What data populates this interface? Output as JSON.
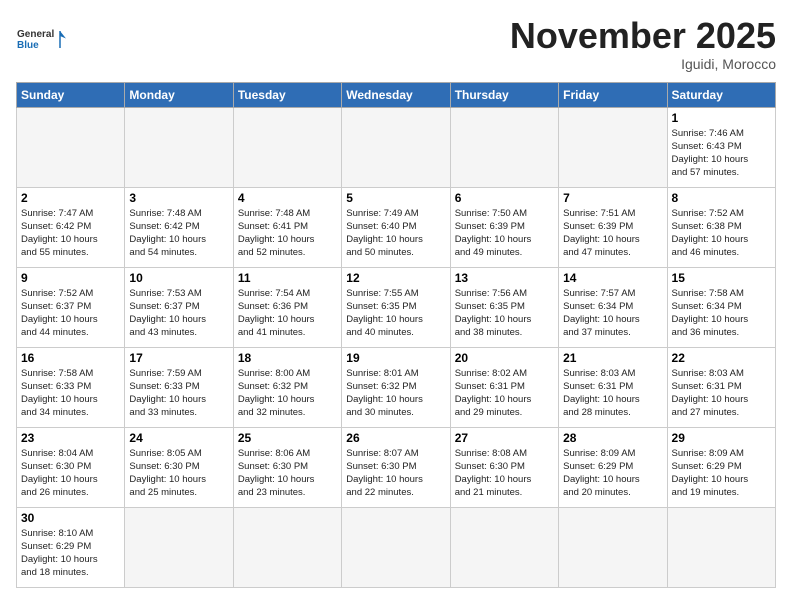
{
  "header": {
    "logo_general": "General",
    "logo_blue": "Blue",
    "month_title": "November 2025",
    "location": "Iguidi, Morocco"
  },
  "days_of_week": [
    "Sunday",
    "Monday",
    "Tuesday",
    "Wednesday",
    "Thursday",
    "Friday",
    "Saturday"
  ],
  "weeks": [
    [
      {
        "day": "",
        "info": ""
      },
      {
        "day": "",
        "info": ""
      },
      {
        "day": "",
        "info": ""
      },
      {
        "day": "",
        "info": ""
      },
      {
        "day": "",
        "info": ""
      },
      {
        "day": "",
        "info": ""
      },
      {
        "day": "1",
        "info": "Sunrise: 7:46 AM\nSunset: 6:43 PM\nDaylight: 10 hours\nand 57 minutes."
      }
    ],
    [
      {
        "day": "2",
        "info": "Sunrise: 7:47 AM\nSunset: 6:42 PM\nDaylight: 10 hours\nand 55 minutes."
      },
      {
        "day": "3",
        "info": "Sunrise: 7:48 AM\nSunset: 6:42 PM\nDaylight: 10 hours\nand 54 minutes."
      },
      {
        "day": "4",
        "info": "Sunrise: 7:48 AM\nSunset: 6:41 PM\nDaylight: 10 hours\nand 52 minutes."
      },
      {
        "day": "5",
        "info": "Sunrise: 7:49 AM\nSunset: 6:40 PM\nDaylight: 10 hours\nand 50 minutes."
      },
      {
        "day": "6",
        "info": "Sunrise: 7:50 AM\nSunset: 6:39 PM\nDaylight: 10 hours\nand 49 minutes."
      },
      {
        "day": "7",
        "info": "Sunrise: 7:51 AM\nSunset: 6:39 PM\nDaylight: 10 hours\nand 47 minutes."
      },
      {
        "day": "8",
        "info": "Sunrise: 7:52 AM\nSunset: 6:38 PM\nDaylight: 10 hours\nand 46 minutes."
      }
    ],
    [
      {
        "day": "9",
        "info": "Sunrise: 7:52 AM\nSunset: 6:37 PM\nDaylight: 10 hours\nand 44 minutes."
      },
      {
        "day": "10",
        "info": "Sunrise: 7:53 AM\nSunset: 6:37 PM\nDaylight: 10 hours\nand 43 minutes."
      },
      {
        "day": "11",
        "info": "Sunrise: 7:54 AM\nSunset: 6:36 PM\nDaylight: 10 hours\nand 41 minutes."
      },
      {
        "day": "12",
        "info": "Sunrise: 7:55 AM\nSunset: 6:35 PM\nDaylight: 10 hours\nand 40 minutes."
      },
      {
        "day": "13",
        "info": "Sunrise: 7:56 AM\nSunset: 6:35 PM\nDaylight: 10 hours\nand 38 minutes."
      },
      {
        "day": "14",
        "info": "Sunrise: 7:57 AM\nSunset: 6:34 PM\nDaylight: 10 hours\nand 37 minutes."
      },
      {
        "day": "15",
        "info": "Sunrise: 7:58 AM\nSunset: 6:34 PM\nDaylight: 10 hours\nand 36 minutes."
      }
    ],
    [
      {
        "day": "16",
        "info": "Sunrise: 7:58 AM\nSunset: 6:33 PM\nDaylight: 10 hours\nand 34 minutes."
      },
      {
        "day": "17",
        "info": "Sunrise: 7:59 AM\nSunset: 6:33 PM\nDaylight: 10 hours\nand 33 minutes."
      },
      {
        "day": "18",
        "info": "Sunrise: 8:00 AM\nSunset: 6:32 PM\nDaylight: 10 hours\nand 32 minutes."
      },
      {
        "day": "19",
        "info": "Sunrise: 8:01 AM\nSunset: 6:32 PM\nDaylight: 10 hours\nand 30 minutes."
      },
      {
        "day": "20",
        "info": "Sunrise: 8:02 AM\nSunset: 6:31 PM\nDaylight: 10 hours\nand 29 minutes."
      },
      {
        "day": "21",
        "info": "Sunrise: 8:03 AM\nSunset: 6:31 PM\nDaylight: 10 hours\nand 28 minutes."
      },
      {
        "day": "22",
        "info": "Sunrise: 8:03 AM\nSunset: 6:31 PM\nDaylight: 10 hours\nand 27 minutes."
      }
    ],
    [
      {
        "day": "23",
        "info": "Sunrise: 8:04 AM\nSunset: 6:30 PM\nDaylight: 10 hours\nand 26 minutes."
      },
      {
        "day": "24",
        "info": "Sunrise: 8:05 AM\nSunset: 6:30 PM\nDaylight: 10 hours\nand 25 minutes."
      },
      {
        "day": "25",
        "info": "Sunrise: 8:06 AM\nSunset: 6:30 PM\nDaylight: 10 hours\nand 23 minutes."
      },
      {
        "day": "26",
        "info": "Sunrise: 8:07 AM\nSunset: 6:30 PM\nDaylight: 10 hours\nand 22 minutes."
      },
      {
        "day": "27",
        "info": "Sunrise: 8:08 AM\nSunset: 6:30 PM\nDaylight: 10 hours\nand 21 minutes."
      },
      {
        "day": "28",
        "info": "Sunrise: 8:09 AM\nSunset: 6:29 PM\nDaylight: 10 hours\nand 20 minutes."
      },
      {
        "day": "29",
        "info": "Sunrise: 8:09 AM\nSunset: 6:29 PM\nDaylight: 10 hours\nand 19 minutes."
      }
    ],
    [
      {
        "day": "30",
        "info": "Sunrise: 8:10 AM\nSunset: 6:29 PM\nDaylight: 10 hours\nand 18 minutes."
      },
      {
        "day": "",
        "info": ""
      },
      {
        "day": "",
        "info": ""
      },
      {
        "day": "",
        "info": ""
      },
      {
        "day": "",
        "info": ""
      },
      {
        "day": "",
        "info": ""
      },
      {
        "day": "",
        "info": ""
      }
    ]
  ]
}
